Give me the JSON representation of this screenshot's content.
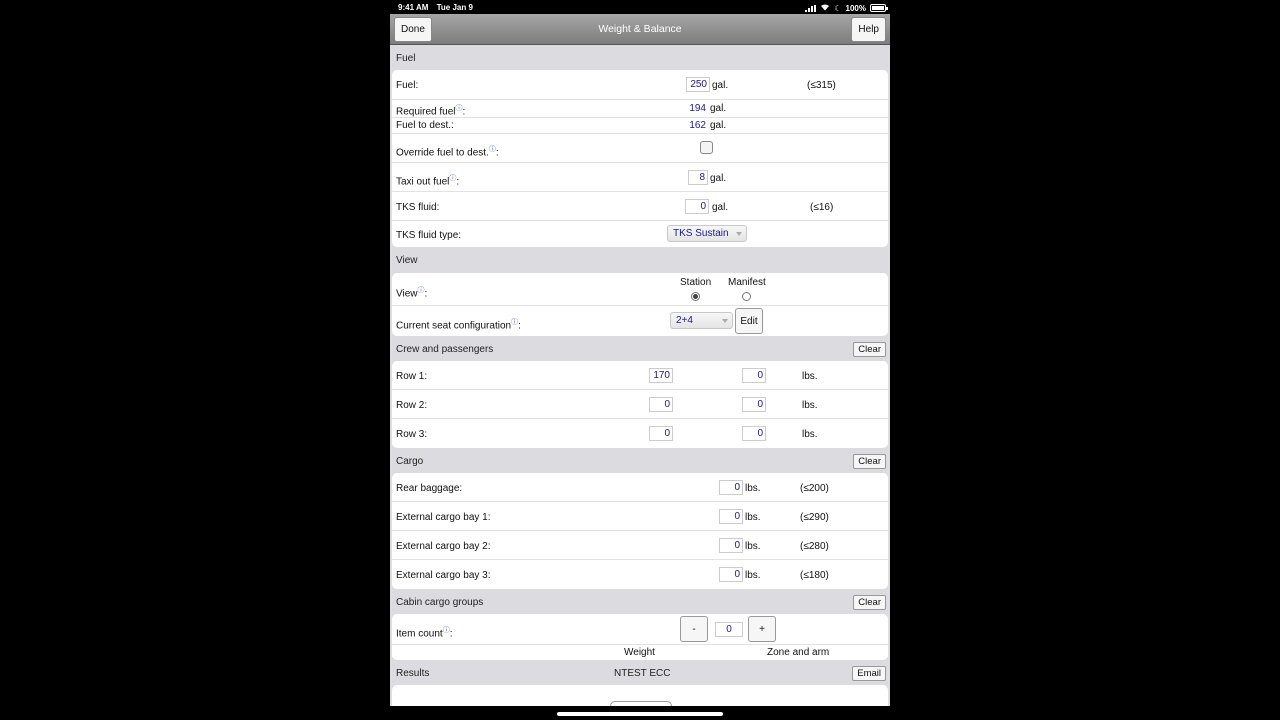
{
  "status_bar": {
    "time": "9:41 AM",
    "date": "Tue Jan 9",
    "battery": "100%",
    "battery_level": 1.0
  },
  "nav": {
    "done": "Done",
    "title": "Weight & Balance",
    "help": "Help"
  },
  "info_icon": "ⓘ",
  "fuel": {
    "header": "Fuel",
    "fuel_label": "Fuel:",
    "fuel_value": "250",
    "fuel_unit": "gal.",
    "fuel_max": "(≤315)",
    "required_label": "Required fuel",
    "required_value": "194",
    "required_unit": "gal.",
    "dest_label": "Fuel to dest.:",
    "dest_value": "162",
    "dest_unit": "gal.",
    "override_label": "Override fuel to dest.",
    "override_checked": false,
    "taxi_label": "Taxi out fuel",
    "taxi_value": "8",
    "taxi_unit": "gal.",
    "tks_label": "TKS fluid:",
    "tks_value": "0",
    "tks_unit": "gal.",
    "tks_max": "(≤16)",
    "tks_type_label": "TKS fluid type:",
    "tks_type_value": "TKS Sustain"
  },
  "view": {
    "header": "View",
    "view_label": "View",
    "option_station": "Station",
    "option_manifest": "Manifest",
    "selected": "Station",
    "seat_label": "Current seat configuration",
    "seat_value": "2+4",
    "edit": "Edit"
  },
  "crew": {
    "header": "Crew and passengers",
    "clear": "Clear",
    "unit": "lbs.",
    "rows": [
      {
        "label": "Row 1:",
        "left": "170",
        "right": "0"
      },
      {
        "label": "Row 2:",
        "left": "0",
        "right": "0"
      },
      {
        "label": "Row 3:",
        "left": "0",
        "right": "0"
      }
    ]
  },
  "cargo": {
    "header": "Cargo",
    "clear": "Clear",
    "unit": "lbs.",
    "rows": [
      {
        "label": "Rear baggage:",
        "value": "0",
        "max": "(≤200)"
      },
      {
        "label": "External cargo bay 1:",
        "value": "0",
        "max": "(≤290)"
      },
      {
        "label": "External cargo bay 2:",
        "value": "0",
        "max": "(≤280)"
      },
      {
        "label": "External cargo bay 3:",
        "value": "0",
        "max": "(≤180)"
      }
    ]
  },
  "cabin": {
    "header": "Cabin cargo groups",
    "clear": "Clear",
    "item_count_label": "Item count",
    "minus": "-",
    "count": "0",
    "plus": "+",
    "col_weight": "Weight",
    "col_zone": "Zone and arm"
  },
  "results": {
    "header": "Results",
    "center": "NTEST ECC",
    "email": "Email"
  }
}
